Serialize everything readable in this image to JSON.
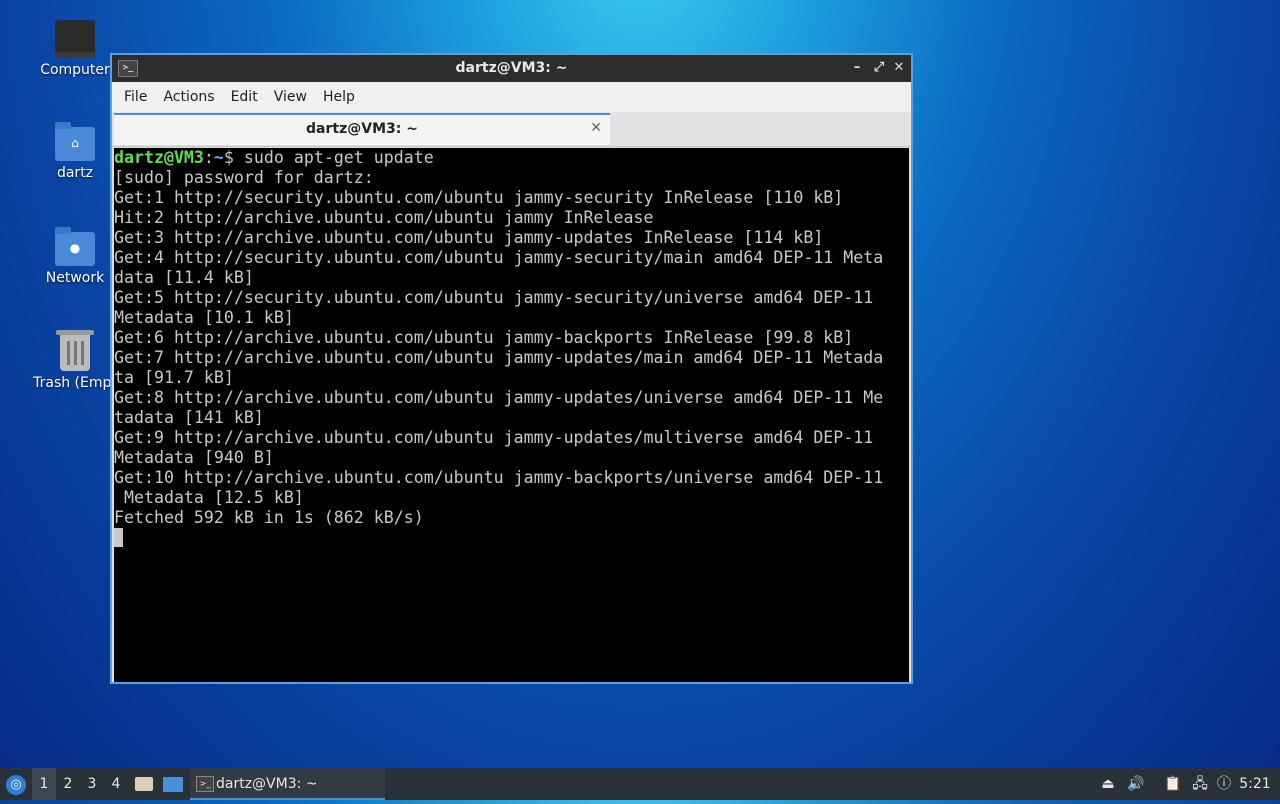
{
  "desktop": {
    "icons": [
      {
        "label": "Computer"
      },
      {
        "label": "dartz"
      },
      {
        "label": "Network"
      },
      {
        "label": "Trash (Empt"
      }
    ]
  },
  "window": {
    "title": "dartz@VM3: ~",
    "controls": {
      "minimize": "–",
      "maximize": "⤢",
      "close": "✕"
    },
    "menu": [
      "File",
      "Actions",
      "Edit",
      "View",
      "Help"
    ],
    "tab": {
      "label": "dartz@VM3: ~",
      "close": "✕"
    }
  },
  "terminal": {
    "prompt_user": "dartz@VM3",
    "prompt_sep": ":",
    "prompt_path": "~",
    "prompt_cmd": "$ sudo apt-get update",
    "lines": [
      "[sudo] password for dartz:",
      "Get:1 http://security.ubuntu.com/ubuntu jammy-security InRelease [110 kB]",
      "Hit:2 http://archive.ubuntu.com/ubuntu jammy InRelease",
      "Get:3 http://archive.ubuntu.com/ubuntu jammy-updates InRelease [114 kB]",
      "Get:4 http://security.ubuntu.com/ubuntu jammy-security/main amd64 DEP-11 Meta",
      "data [11.4 kB]",
      "Get:5 http://security.ubuntu.com/ubuntu jammy-security/universe amd64 DEP-11",
      "Metadata [10.1 kB]",
      "Get:6 http://archive.ubuntu.com/ubuntu jammy-backports InRelease [99.8 kB]",
      "Get:7 http://archive.ubuntu.com/ubuntu jammy-updates/main amd64 DEP-11 Metada",
      "ta [91.7 kB]",
      "Get:8 http://archive.ubuntu.com/ubuntu jammy-updates/universe amd64 DEP-11 Me",
      "tadata [141 kB]",
      "Get:9 http://archive.ubuntu.com/ubuntu jammy-updates/multiverse amd64 DEP-11",
      "Metadata [940 B]",
      "Get:10 http://archive.ubuntu.com/ubuntu jammy-backports/universe amd64 DEP-11",
      " Metadata [12.5 kB]",
      "Fetched 592 kB in 1s (862 kB/s)"
    ]
  },
  "taskbar": {
    "workspaces": [
      "1",
      "2",
      "3",
      "4"
    ],
    "task_label": "dartz@VM3: ~",
    "clock": "5:21",
    "tray_icons": [
      "drive-eject-icon",
      "volume-icon",
      "clipboard-icon",
      "network-icon",
      "notification-icon"
    ]
  }
}
